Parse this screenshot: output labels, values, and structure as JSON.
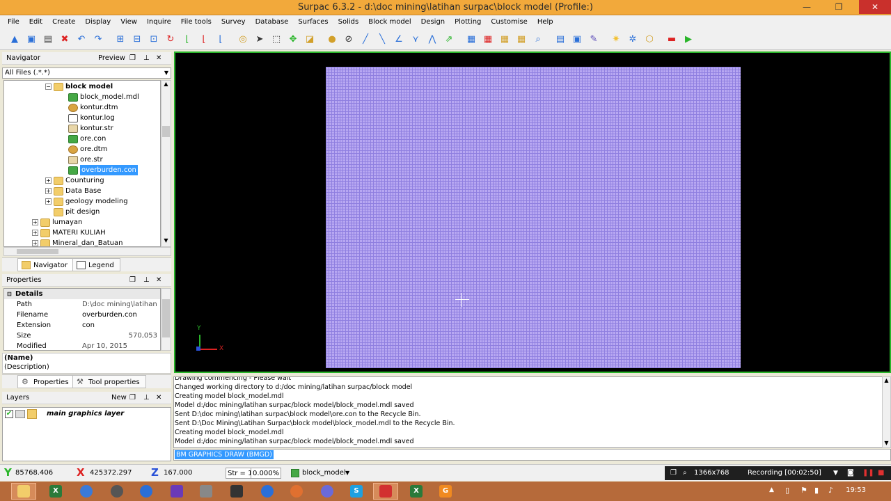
{
  "window": {
    "title": "Surpac 6.3.2 - d:\\doc mining\\latihan surpac\\block model (Profile:)",
    "minimize": "—",
    "restore": "❐",
    "close": "✕"
  },
  "menu": [
    "File",
    "Edit",
    "Create",
    "Display",
    "View",
    "Inquire",
    "File tools",
    "Survey",
    "Database",
    "Surfaces",
    "Solids",
    "Block model",
    "Design",
    "Plotting",
    "Customise",
    "Help"
  ],
  "navigator": {
    "title": "Navigator",
    "preview": "Preview",
    "filter": "All Files (.*.*)",
    "tree": [
      {
        "label": "block model",
        "indent": 0,
        "type": "folder",
        "bold": true,
        "expander": "−"
      },
      {
        "label": "block_model.mdl",
        "indent": 1,
        "type": "cube"
      },
      {
        "label": "kontur.dtm",
        "indent": 1,
        "type": "dtm"
      },
      {
        "label": "kontur.log",
        "indent": 1,
        "type": "log"
      },
      {
        "label": "kontur.str",
        "indent": 1,
        "type": "str"
      },
      {
        "label": "ore.con",
        "indent": 1,
        "type": "cube"
      },
      {
        "label": "ore.dtm",
        "indent": 1,
        "type": "dtm"
      },
      {
        "label": "ore.str",
        "indent": 1,
        "type": "str"
      },
      {
        "label": "overburden.con",
        "indent": 1,
        "type": "cube",
        "selected": true
      },
      {
        "label": "Counturing",
        "indent": 0,
        "type": "folder",
        "expander": "+"
      },
      {
        "label": "Data Base",
        "indent": 0,
        "type": "folder",
        "expander": "+"
      },
      {
        "label": "geology modeling",
        "indent": 0,
        "type": "folder",
        "expander": "+"
      },
      {
        "label": "pit design",
        "indent": 0,
        "type": "folder"
      },
      {
        "label": "lumayan",
        "indent": -1,
        "type": "folder",
        "expander": "+"
      },
      {
        "label": "MATERI KULIAH",
        "indent": -1,
        "type": "folder",
        "expander": "+"
      },
      {
        "label": "Mineral_dan_Batuan",
        "indent": -1,
        "type": "folder",
        "expander": "+"
      }
    ],
    "tabs": [
      "Navigator",
      "Legend"
    ]
  },
  "properties": {
    "title": "Properties",
    "section": "Details",
    "rows": [
      {
        "key": "Path",
        "value": "D:\\doc mining\\latihan ..."
      },
      {
        "key": "Filename",
        "value": "overburden.con"
      },
      {
        "key": "Extension",
        "value": "con"
      },
      {
        "key": "Size",
        "value": "570,053"
      },
      {
        "key": "Modified",
        "value": "Apr 10, 2015"
      }
    ],
    "name_label": "(Name)",
    "description_label": "(Description)",
    "tabs": [
      "Properties",
      "Tool properties"
    ]
  },
  "layers": {
    "title": "Layers",
    "new_label": "New",
    "items": [
      "main graphics layer"
    ]
  },
  "viewport": {
    "axis_y": "Y",
    "axis_x": "X"
  },
  "console": {
    "lines": [
      "Drawing commencing - Please wait",
      "Changed working directory to d:/doc mining/latihan surpac/block model",
      "Creating model block_model.mdl",
      "Model d:/doc mining/latihan surpac/block model/block_model.mdl saved",
      "Sent D:\\doc mining\\latihan surpac\\block model\\ore.con to the Recycle Bin.",
      "Sent D:\\Doc Mining\\Latihan Surpac\\block model\\block_model.mdl to the Recycle Bin.",
      "Creating model block_model.mdl",
      "Model d:/doc mining/latihan surpac/block model/block_model.mdl saved"
    ],
    "command": "BM GRAPHICS DRAW (BMGD)"
  },
  "status": {
    "y": "85768.406",
    "x": "425372.297",
    "z": "167.000",
    "str_label": "Str = 1",
    "zoom": "0.000%",
    "model": "block_model",
    "resolution": "1366x768",
    "recording": "Recording [00:02:50]"
  },
  "taskbar": {
    "clock": "19:53"
  },
  "colors": {
    "titlebar": "#f2a93b",
    "viewport_border": "#2ab52a",
    "block_model": "#b8a8f2",
    "selection": "#3399ff",
    "taskbar": "#b66a3a"
  }
}
